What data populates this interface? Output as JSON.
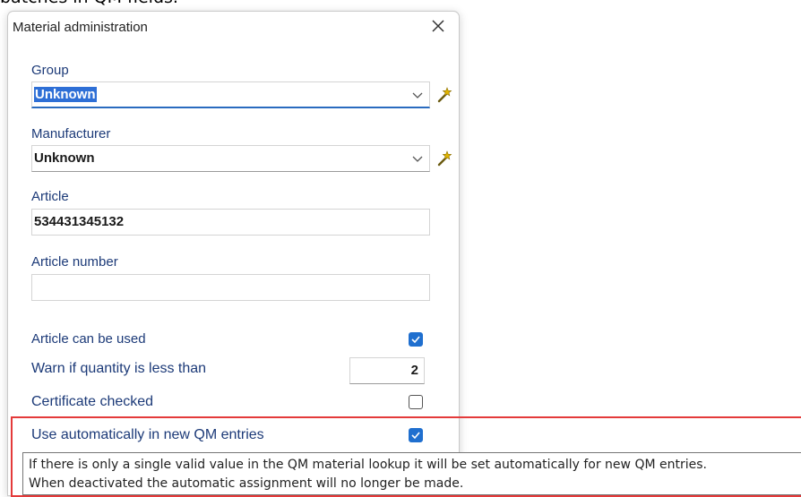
{
  "background": {
    "partial_text": "batches in QM fields."
  },
  "dialog": {
    "title": "Material administration",
    "close_label": "×",
    "group": {
      "label": "Group",
      "value": "Unknown"
    },
    "manufacturer": {
      "label": "Manufacturer",
      "value": "Unknown"
    },
    "article": {
      "label": "Article",
      "value": "534431345132"
    },
    "article_number": {
      "label": "Article number",
      "value": ""
    },
    "options": {
      "can_be_used": {
        "label": "Article can be used",
        "checked": true
      },
      "warn_quantity": {
        "label": "Warn if quantity is less than",
        "value": "2"
      },
      "certificate": {
        "label": "Certificate checked",
        "checked": false
      },
      "auto_qm": {
        "label": "Use automatically in new QM entries",
        "checked": true
      }
    }
  },
  "tooltip": {
    "line1": "If there is only a single valid value in the QM material lookup it will be set automatically for new QM entries.",
    "line2": "When deactivated the automatic assignment will no longer be made."
  },
  "colors": {
    "accent": "#1f6fcf",
    "label": "#1c3a78",
    "highlight": "#e43a3a",
    "wand": "#e0b400"
  },
  "icons": {
    "close": "close-icon",
    "chevron": "chevron-down-icon",
    "wand": "magic-wand-icon",
    "check": "checkmark-icon"
  }
}
